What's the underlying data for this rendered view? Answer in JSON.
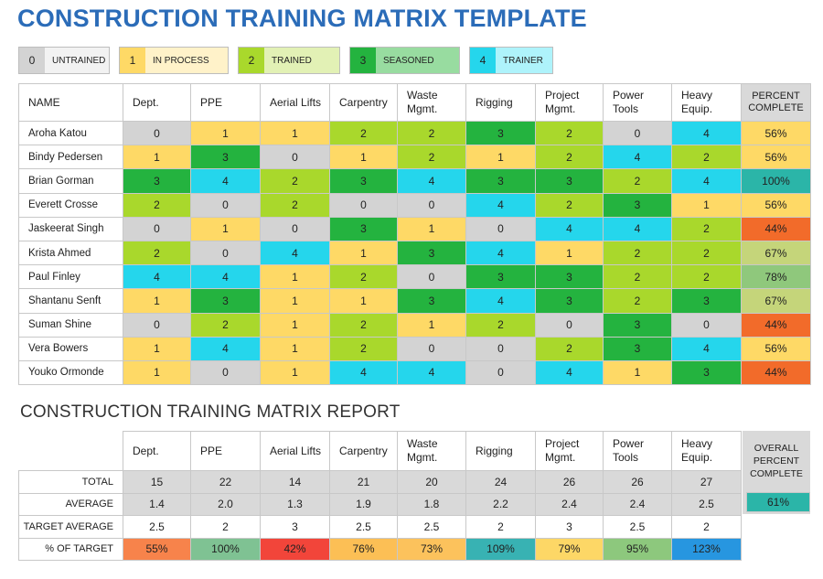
{
  "title": "CONSTRUCTION TRAINING MATRIX TEMPLATE",
  "colors": {
    "0": "#d3d3d3",
    "1": "#fed966",
    "2": "#a9d82c",
    "3": "#24b33f",
    "4": "#25d6ec",
    "title": "#2b6cb8"
  },
  "legend": [
    {
      "num": "0",
      "label": "UNTRAINED",
      "color": "#d3d3d3",
      "label_bg": "#f2f2f2"
    },
    {
      "num": "1",
      "label": "IN PROCESS",
      "color": "#fed966",
      "label_bg": "#fff2c9"
    },
    {
      "num": "2",
      "label": "TRAINED",
      "color": "#a9d82c",
      "label_bg": "#e2f1b5"
    },
    {
      "num": "3",
      "label": "SEASONED",
      "color": "#24b33f",
      "label_bg": "#98dca0"
    },
    {
      "num": "4",
      "label": "TRAINER",
      "color": "#25d6ec",
      "label_bg": "#aef3fb"
    }
  ],
  "matrix": {
    "name_header": "NAME",
    "columns": [
      "Dept.",
      "PPE",
      "Aerial Lifts",
      "Carpentry",
      "Waste Mgmt.",
      "Rigging",
      "Project Mgmt.",
      "Power Tools",
      "Heavy Equip."
    ],
    "percent_header": "PERCENT COMPLETE",
    "rows": [
      {
        "name": "Aroha Katou",
        "values": [
          0,
          1,
          1,
          2,
          2,
          3,
          2,
          0,
          4
        ],
        "percent": "56%",
        "pct_color": "#fed966"
      },
      {
        "name": "Bindy Pedersen",
        "values": [
          1,
          3,
          0,
          1,
          2,
          1,
          2,
          4,
          2
        ],
        "percent": "56%",
        "pct_color": "#fed966"
      },
      {
        "name": "Brian Gorman",
        "values": [
          3,
          4,
          2,
          3,
          4,
          3,
          3,
          2,
          4
        ],
        "percent": "100%",
        "pct_color": "#2bb5a8"
      },
      {
        "name": "Everett Crosse",
        "values": [
          2,
          0,
          2,
          0,
          0,
          4,
          2,
          3,
          1
        ],
        "percent": "56%",
        "pct_color": "#fed966"
      },
      {
        "name": "Jaskeerat Singh",
        "values": [
          0,
          1,
          0,
          3,
          1,
          0,
          4,
          4,
          2
        ],
        "percent": "44%",
        "pct_color": "#f26b2a"
      },
      {
        "name": "Krista Ahmed",
        "values": [
          2,
          0,
          4,
          1,
          3,
          4,
          1,
          2,
          2
        ],
        "percent": "67%",
        "pct_color": "#c5d57a"
      },
      {
        "name": "Paul Finley",
        "values": [
          4,
          4,
          1,
          2,
          0,
          3,
          3,
          2,
          2
        ],
        "percent": "78%",
        "pct_color": "#8fc87c"
      },
      {
        "name": "Shantanu Senft",
        "values": [
          1,
          3,
          1,
          1,
          3,
          4,
          3,
          2,
          3
        ],
        "percent": "67%",
        "pct_color": "#c5d57a"
      },
      {
        "name": "Suman Shine",
        "values": [
          0,
          2,
          1,
          2,
          1,
          2,
          0,
          3,
          0
        ],
        "percent": "44%",
        "pct_color": "#f26b2a"
      },
      {
        "name": "Vera Bowers",
        "values": [
          1,
          4,
          1,
          2,
          0,
          0,
          2,
          3,
          4
        ],
        "percent": "56%",
        "pct_color": "#fed966"
      },
      {
        "name": "Youko Ormonde",
        "values": [
          1,
          0,
          1,
          4,
          4,
          0,
          4,
          1,
          3
        ],
        "percent": "44%",
        "pct_color": "#f26b2a"
      }
    ]
  },
  "report": {
    "title": "CONSTRUCTION TRAINING MATRIX REPORT",
    "columns": [
      "Dept.",
      "PPE",
      "Aerial Lifts",
      "Carpentry",
      "Waste Mgmt.",
      "Rigging",
      "Project Mgmt.",
      "Power Tools",
      "Heavy Equip."
    ],
    "rows": [
      {
        "label": "TOTAL",
        "values": [
          "15",
          "22",
          "14",
          "21",
          "20",
          "24",
          "26",
          "26",
          "27"
        ],
        "style": "gray"
      },
      {
        "label": "AVERAGE",
        "values": [
          "1.4",
          "2.0",
          "1.3",
          "1.9",
          "1.8",
          "2.2",
          "2.4",
          "2.4",
          "2.5"
        ],
        "style": "gray"
      },
      {
        "label": "TARGET AVERAGE",
        "values": [
          "2.5",
          "2",
          "3",
          "2.5",
          "2.5",
          "2",
          "3",
          "2.5",
          "2"
        ],
        "style": "white"
      },
      {
        "label": "% OF TARGET",
        "values": [
          "55%",
          "100%",
          "42%",
          "76%",
          "73%",
          "109%",
          "79%",
          "95%",
          "123%"
        ],
        "style": "colored",
        "colors": [
          "#f7834b",
          "#7fc293",
          "#f2453a",
          "#fcbf55",
          "#fcc25c",
          "#38b2b3",
          "#fdd766",
          "#8dc87d",
          "#2796e0"
        ]
      }
    ],
    "overall_header": "OVERALL PERCENT COMPLETE",
    "overall_value": "61%",
    "overall_color": "#2bb5a8"
  }
}
